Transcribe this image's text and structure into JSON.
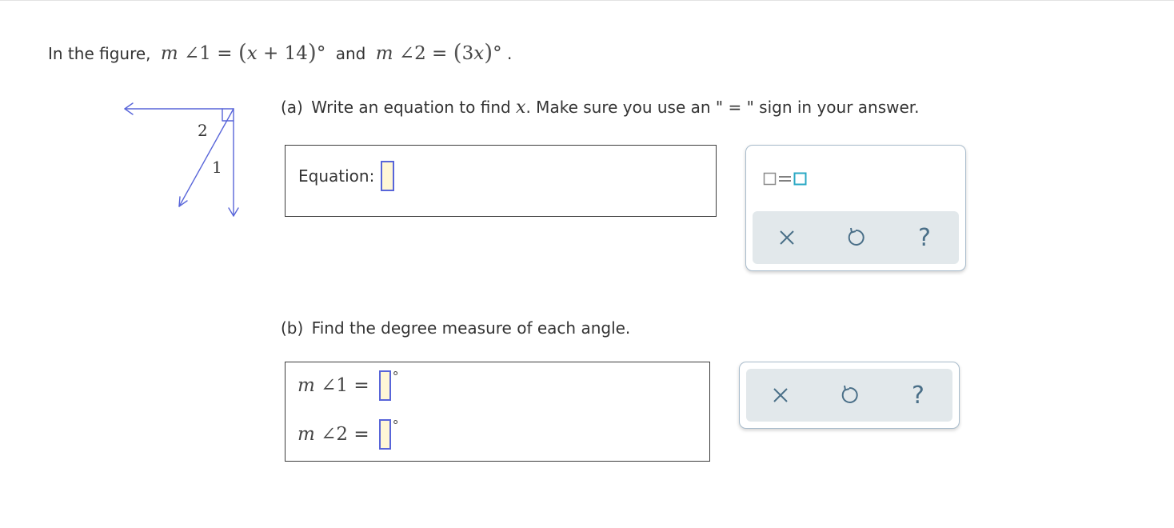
{
  "prompt": {
    "intro": "In the figure,",
    "angle1_text": "m∠1 = (x + 14)°",
    "conj": "and",
    "angle2_text": "m∠2 = (3x)°",
    "end": "."
  },
  "figure": {
    "label_2": "2",
    "label_1": "1",
    "stroke_color": "#5865d9"
  },
  "part_a": {
    "tag": "(a)",
    "text_before": "Write an equation to find",
    "var": "x",
    "text_after": ". Make sure you use an \" = \" sign in your answer.",
    "equation_label": "Equation:",
    "equation_value": ""
  },
  "part_b": {
    "tag": "(b)",
    "text": "Find the degree measure of each angle.",
    "angle1_label": "m∠1 =",
    "angle1_value": "",
    "angle2_label": "m∠2 =",
    "angle2_value": "",
    "degree": "°"
  },
  "tools": {
    "template_icon": "box-equals-box-icon",
    "clear_icon": "x-icon",
    "undo_icon": "undo-icon",
    "help_icon": "question-icon",
    "help_symbol": "?"
  },
  "colors": {
    "accent": "#5865d9",
    "slot_fill": "#fff7d6",
    "icon": "#4a6f88",
    "template_box": "#2aa8c4",
    "toolbar_bg": "#e2e8eb"
  }
}
